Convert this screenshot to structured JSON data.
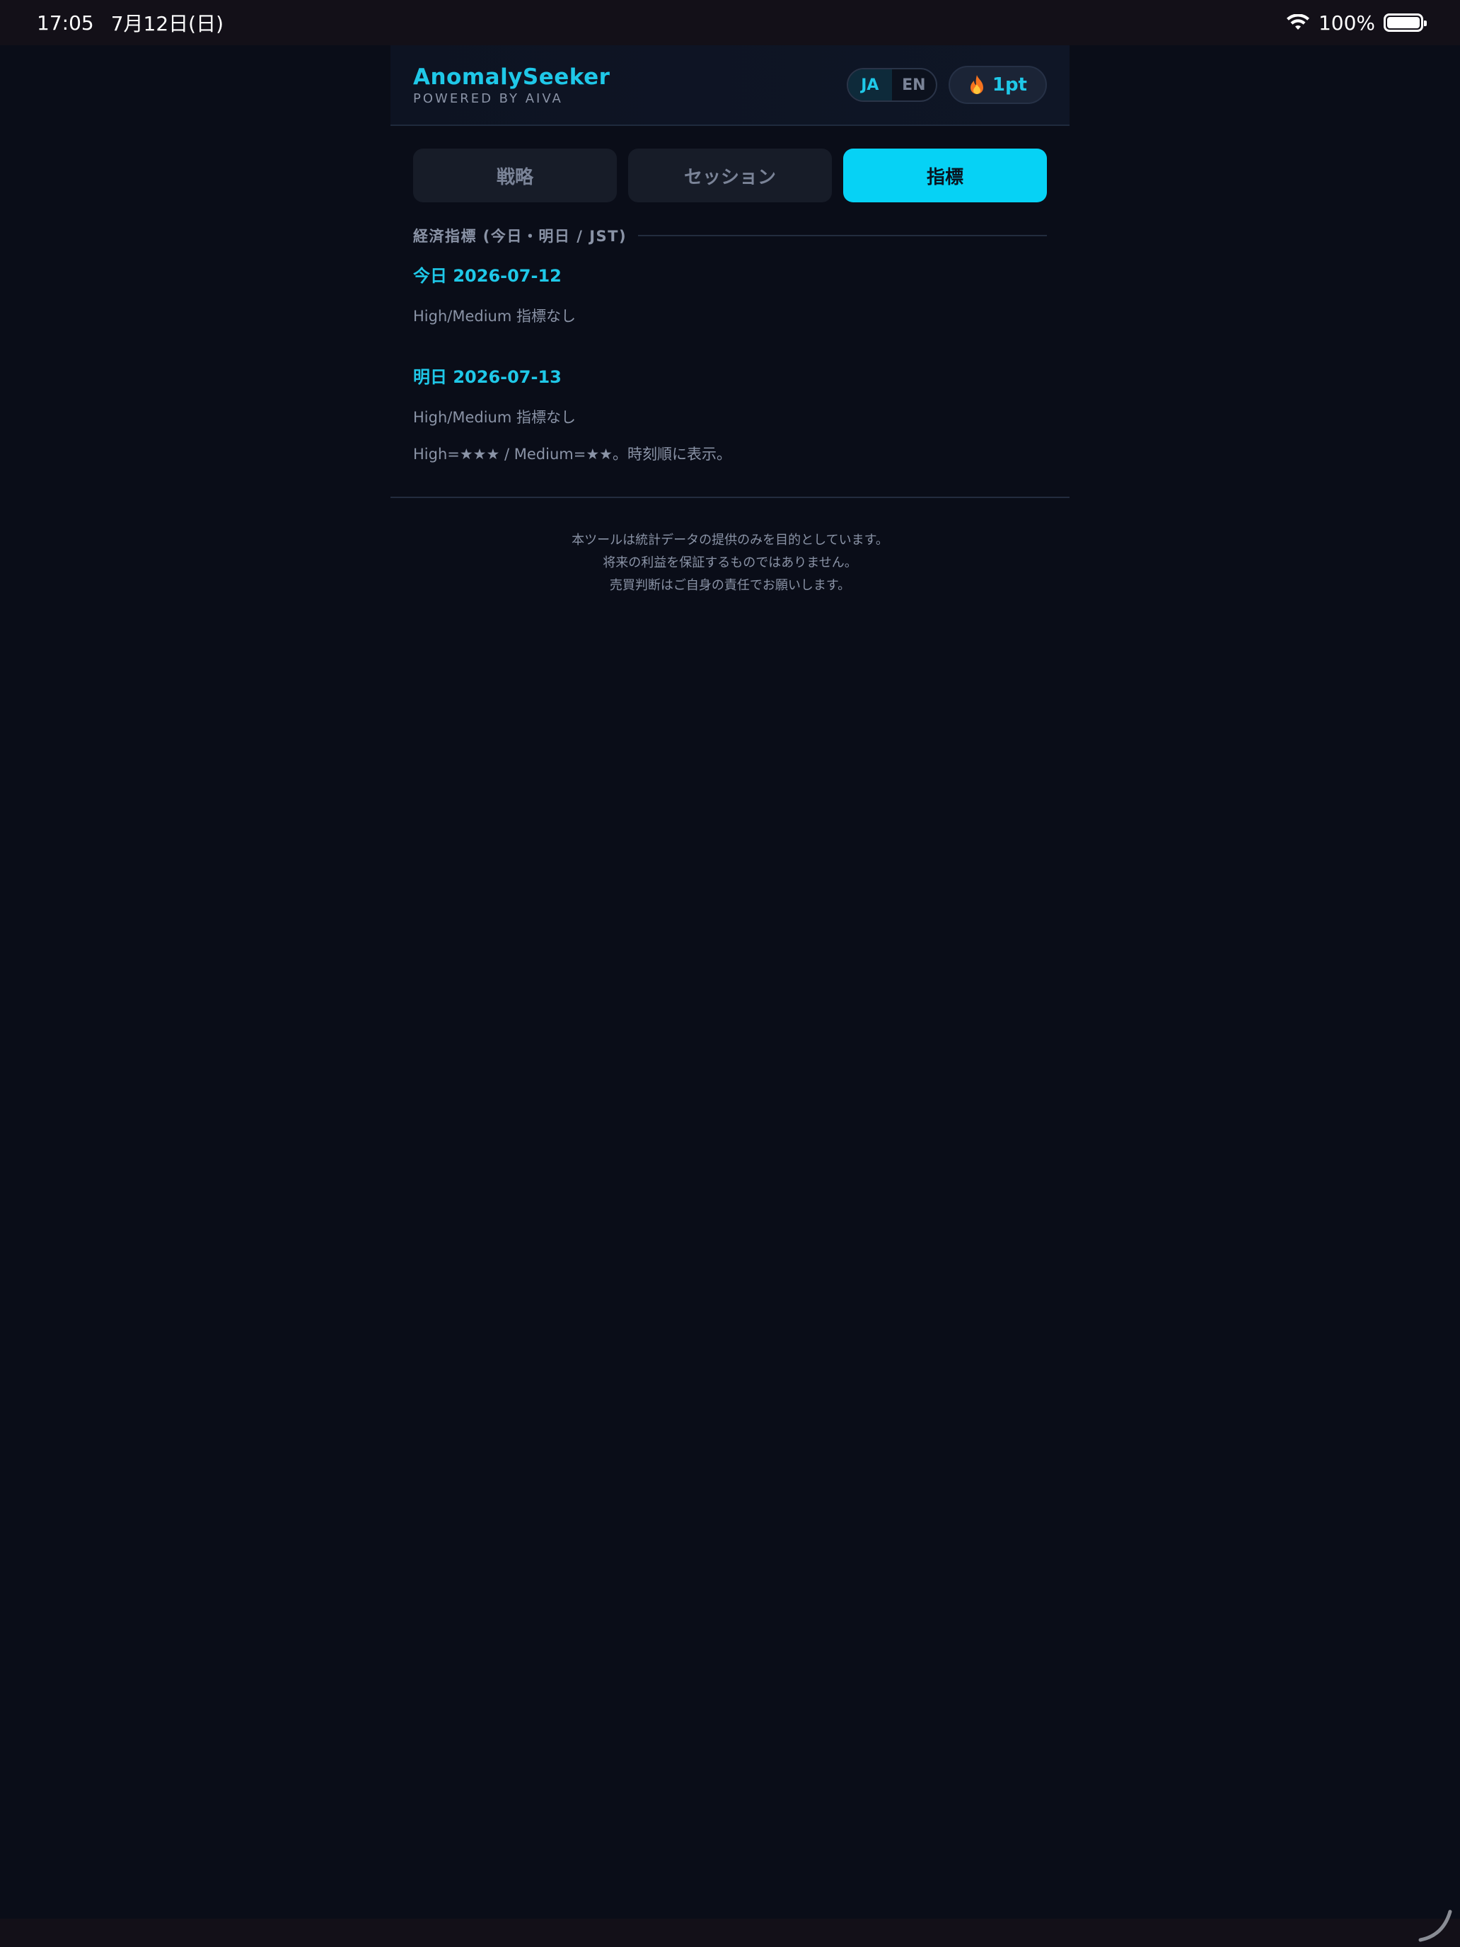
{
  "status_bar": {
    "time": "17:05",
    "date": "7月12日(日)",
    "battery": "100%"
  },
  "header": {
    "brand_title": "AnomalySeeker",
    "brand_subtitle": "POWERED BY AIVA",
    "lang_ja": "JA",
    "lang_en": "EN",
    "points": "1pt",
    "accent_color": "#1fc8e8"
  },
  "tabs": [
    {
      "label": "戦略",
      "active": false
    },
    {
      "label": "セッション",
      "active": false
    },
    {
      "label": "指標",
      "active": true
    }
  ],
  "indicators": {
    "section_label": "経済指標 (今日・明日 / JST)",
    "today_title": "今日 2026-07-12",
    "today_note": "High/Medium 指標なし",
    "tomorrow_title": "明日 2026-07-13",
    "tomorrow_note": "High/Medium 指標なし",
    "legend": "High=★★★ / Medium=★★。時刻順に表示。"
  },
  "disclaimer": {
    "line1": "本ツールは統計データの提供のみを目的としています。",
    "line2": "将来の利益を保証するものではありません。",
    "line3": "売買判断はご自身の責任でお願いします。"
  }
}
